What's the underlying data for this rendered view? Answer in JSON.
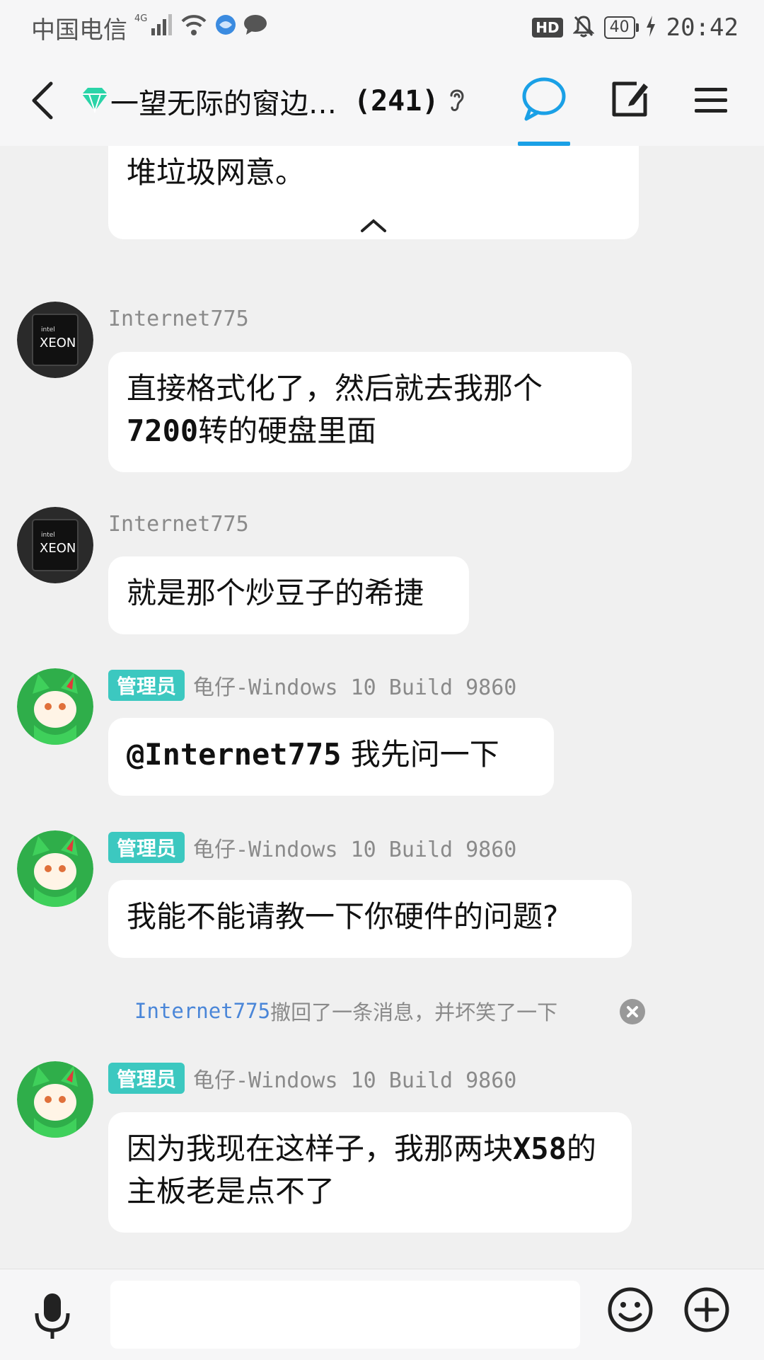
{
  "status_bar": {
    "carrier": "中国电信",
    "network": "4G",
    "hd": "HD",
    "battery": "40",
    "time": "20:42"
  },
  "header": {
    "group_title": "一望无际的窗边…",
    "member_count": "(241)"
  },
  "messages": [
    {
      "type": "text",
      "text": "堆垃圾网意。"
    },
    {
      "type": "text",
      "sender": "Internet775",
      "text_parts": [
        "直接格式化了，然后就去我那个",
        "7200",
        "转的硬盘里面"
      ]
    },
    {
      "type": "text",
      "sender": "Internet775",
      "text": "就是那个炒豆子的希捷"
    },
    {
      "type": "text",
      "badge": "管理员",
      "sender": "龟仔-Windows 10 Build 9860",
      "text_parts": [
        "@Internet775",
        " 我先问一下"
      ]
    },
    {
      "type": "text",
      "badge": "管理员",
      "sender": "龟仔-Windows 10 Build 9860",
      "text": "我能不能请教一下你硬件的问题?"
    },
    {
      "type": "system",
      "user": "Internet775",
      "text": "撤回了一条消息，并坏笑了一下"
    },
    {
      "type": "text",
      "badge": "管理员",
      "sender": "龟仔-Windows 10 Build 9860",
      "text_parts": [
        "因为我现在这样子，我那两块",
        "X58",
        "的主板老是点不了"
      ]
    }
  ],
  "avatar_labels": {
    "xeon_brand": "intel",
    "xeon_text": "XEON"
  },
  "colors": {
    "accent": "#1aa0e6",
    "admin_badge": "#3cc8c0",
    "link": "#4a86d8"
  }
}
